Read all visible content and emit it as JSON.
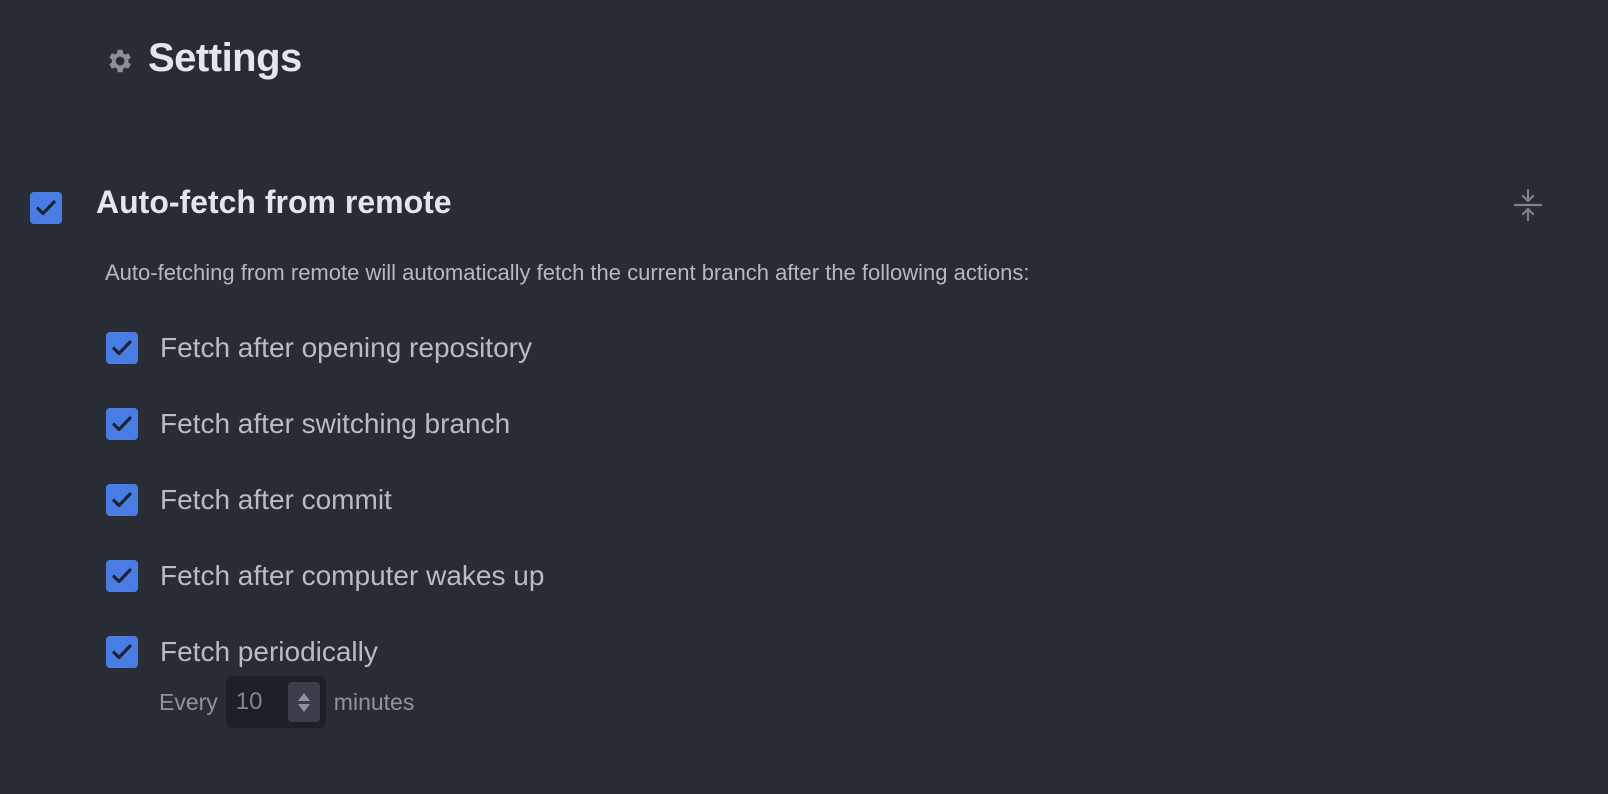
{
  "header": {
    "title": "Settings",
    "icon": "gear-icon"
  },
  "section": {
    "title": "Auto-fetch from remote",
    "enabled": true,
    "description": "Auto-fetching from remote will automatically fetch the current branch after the following actions:",
    "collapse_icon": "collapse-icon"
  },
  "options": [
    {
      "label": "Fetch after opening repository",
      "checked": true
    },
    {
      "label": "Fetch after switching branch",
      "checked": true
    },
    {
      "label": "Fetch after commit",
      "checked": true
    },
    {
      "label": "Fetch after computer wakes up",
      "checked": true
    },
    {
      "label": "Fetch periodically",
      "checked": true
    }
  ],
  "interval": {
    "prefix": "Every",
    "value": "10",
    "suffix": "minutes"
  },
  "colors": {
    "background": "#282c35",
    "checkbox": "#4a7de4",
    "checkmark": "#1c2230",
    "title": "#e4e6ec",
    "text": "#b9bcc5"
  }
}
